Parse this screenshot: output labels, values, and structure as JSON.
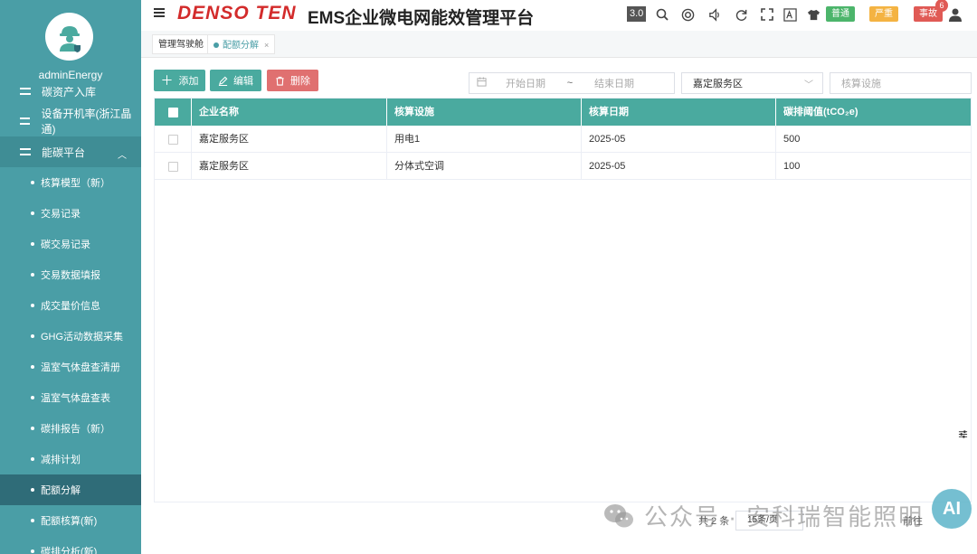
{
  "user": {
    "name": "adminEnergy"
  },
  "sidebar": {
    "items": [
      {
        "label": "碳资产入库"
      },
      {
        "label": "设备开机率(浙江晶通)"
      },
      {
        "label": "能碳平台",
        "expanded": true
      }
    ],
    "sub_items": [
      {
        "label": "核算模型（新）"
      },
      {
        "label": "交易记录"
      },
      {
        "label": "碳交易记录"
      },
      {
        "label": "交易数据填报"
      },
      {
        "label": "成交量价信息"
      },
      {
        "label": "GHG活动数据采集"
      },
      {
        "label": "温室气体盘查清册"
      },
      {
        "label": "温室气体盘查表"
      },
      {
        "label": "碳排报告（新）"
      },
      {
        "label": "减排计划"
      },
      {
        "label": "配额分解",
        "active": true
      },
      {
        "label": "配额核算(新)"
      },
      {
        "label": "碳排分析(新)"
      }
    ]
  },
  "header": {
    "brand": "DENSO TEN",
    "title": "EMS企业微电网能效管理平台",
    "version": "3.0",
    "alarm_normal": "普通",
    "alarm_severe": "严重",
    "alarm_incident": "事故",
    "alarm_count": "6"
  },
  "tabs": [
    {
      "label": "管理驾驶舱"
    },
    {
      "label": "配额分解",
      "active": true,
      "close": "×"
    }
  ],
  "toolbar": {
    "add_label": "添加",
    "edit_label": "编辑",
    "delete_label": "删除",
    "start_date_placeholder": "开始日期",
    "date_separator": "~",
    "end_date_placeholder": "结束日期",
    "org_select_value": "嘉定服务区",
    "facility_placeholder": "核算设施"
  },
  "table": {
    "headers": [
      "企业名称",
      "核算设施",
      "核算日期",
      "碳排阈值(tCO₂e)"
    ],
    "rows": [
      [
        "嘉定服务区",
        "用电1",
        "2025-05",
        "500"
      ],
      [
        "嘉定服务区",
        "分体式空调",
        "2025-05",
        "100"
      ]
    ]
  },
  "pagination": {
    "total_text": "共 2 条",
    "page_size": "15条/页",
    "goto_label": "前往"
  },
  "watermark": {
    "text": "公众号 · 安科瑞智能照明",
    "badge": "AI"
  },
  "colors": {
    "sidebar": "#4a9ea6",
    "accent": "#4aaa9f",
    "danger": "#e07070",
    "brand": "#d32b2b"
  }
}
